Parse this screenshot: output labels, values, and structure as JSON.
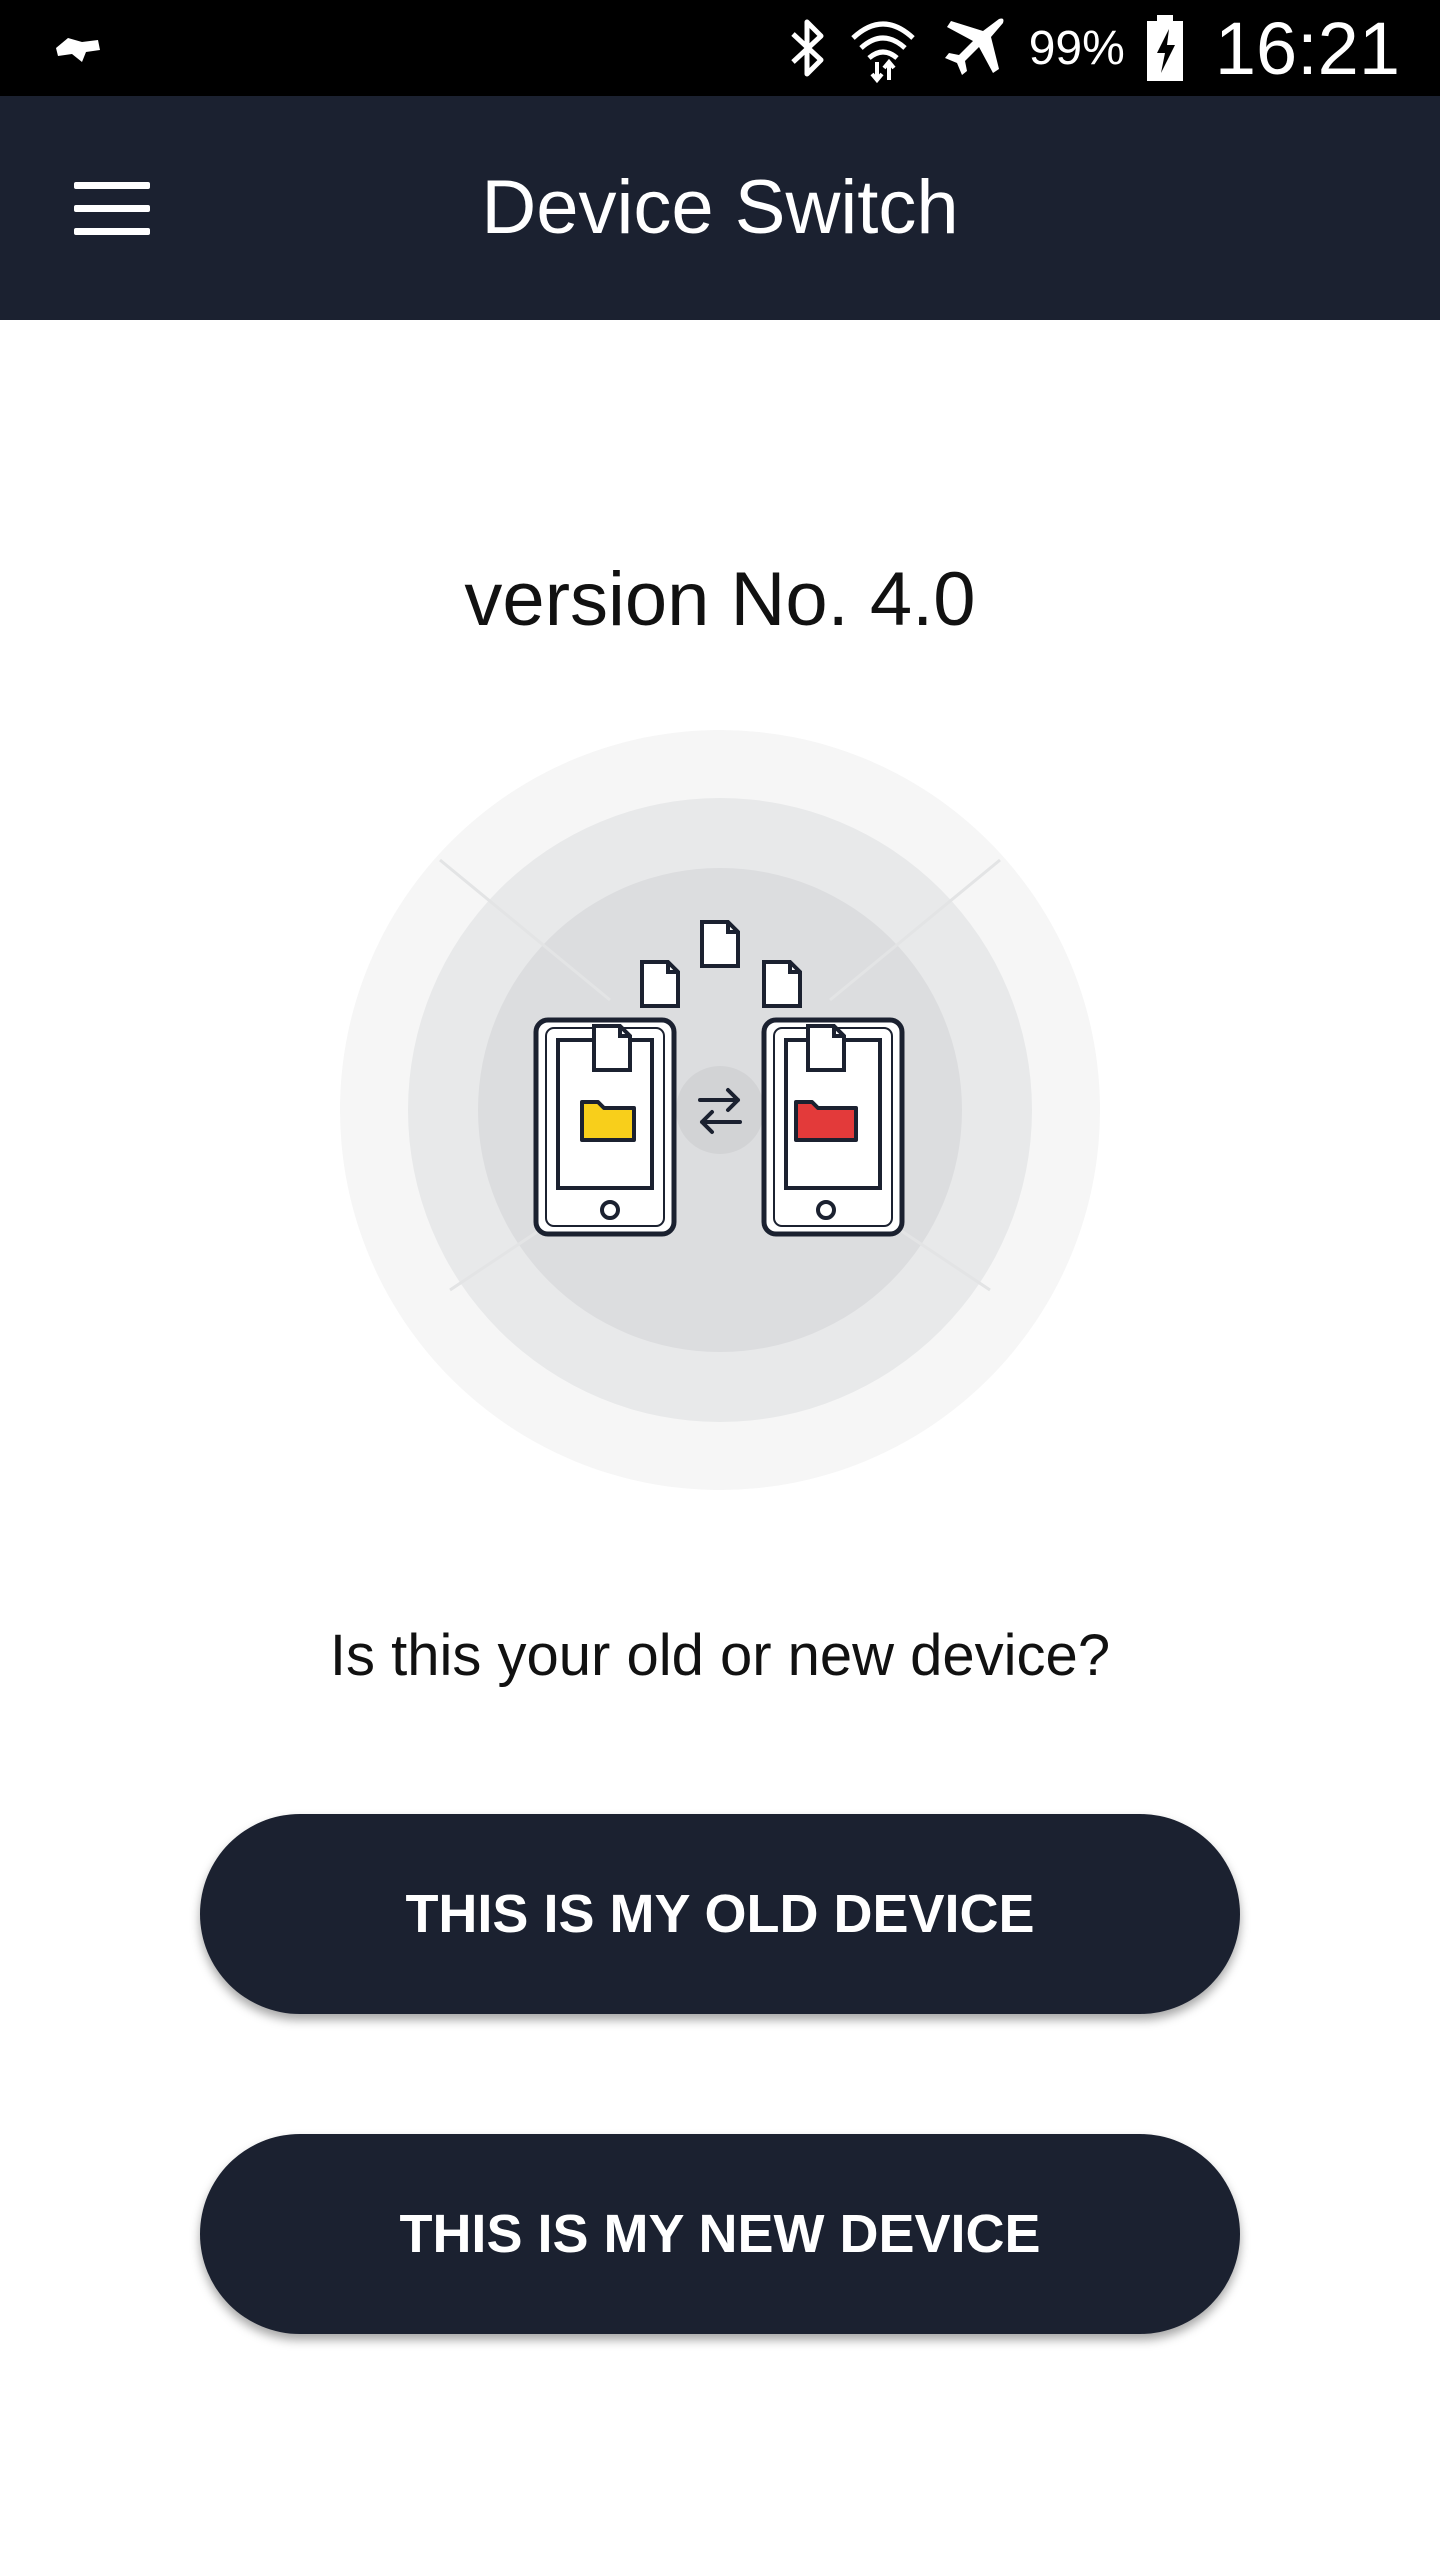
{
  "status_bar": {
    "left_icon": "notification-icon",
    "icons": [
      "bluetooth-icon",
      "wifi-icon",
      "airplane-mode-icon",
      "battery-charging-icon"
    ],
    "battery_percent": "99%",
    "time": "16:21"
  },
  "app_bar": {
    "menu_icon": "hamburger-menu-icon",
    "title": "Device Switch"
  },
  "main": {
    "version": "version No. 4.0",
    "illustration": {
      "icons": [
        "document-icon",
        "phone-icon",
        "folder-icon",
        "swap-arrows-icon"
      ],
      "colors": {
        "circle_outer": "#f5f5f5",
        "circle_middle": "#e8e9ea",
        "circle_inner": "#dcdddf",
        "folder_left": "#f8cf1b",
        "folder_right": "#e33a3a",
        "outline": "#1b2130"
      }
    },
    "question": "Is this your old or new device?",
    "old_device_button": "THIS IS MY OLD DEVICE",
    "new_device_button": "THIS IS MY NEW DEVICE"
  },
  "colors": {
    "app_bar": "#1b2130",
    "button": "#1b2130",
    "status_bar": "#000000",
    "background": "#ffffff"
  }
}
